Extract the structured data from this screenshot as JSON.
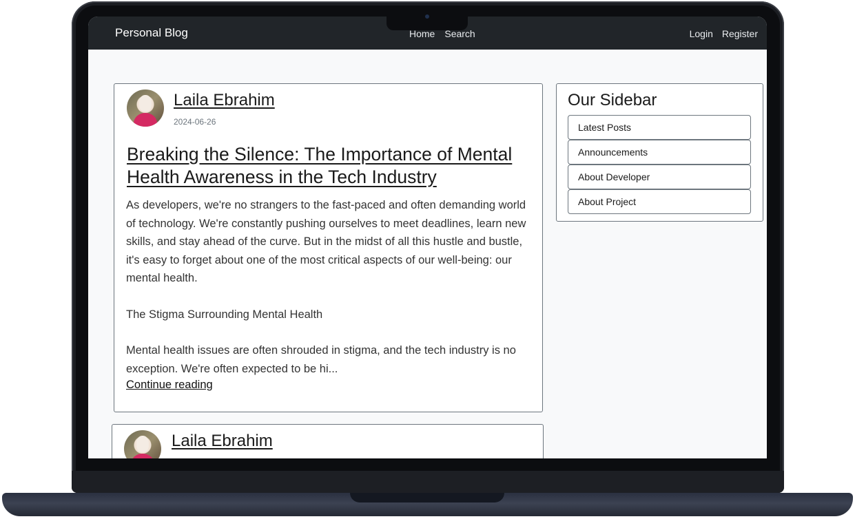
{
  "navbar": {
    "brand": "Personal Blog",
    "center_links": [
      "Home",
      "Search"
    ],
    "right_links": [
      "Login",
      "Register"
    ]
  },
  "posts": [
    {
      "author": "Laila Ebrahim",
      "date": "2024-06-26",
      "title": "Breaking the Silence: The Importance of Mental Health Awareness in the Tech Industry",
      "excerpt": [
        "As developers, we're no strangers to the fast-paced and often demanding world of technology. We're constantly pushing ourselves to meet deadlines, learn new skills, and stay ahead of the curve. But in the midst of all this hustle and bustle, it's easy to forget about one of the most critical aspects of our well-being: our mental health.",
        "The Stigma Surrounding Mental Health",
        "Mental health issues are often shrouded in stigma, and the tech industry is no exception. We're often expected to be hi..."
      ],
      "continue_label": "Continue reading"
    },
    {
      "author": "Laila Ebrahim"
    }
  ],
  "sidebar": {
    "title": "Our Sidebar",
    "items": [
      "Latest Posts",
      "Announcements",
      "About Developer",
      "About Project"
    ]
  },
  "colors": {
    "navbar": "#212529",
    "page_background": "#f8f9fa",
    "card_border": "#6c757d"
  }
}
